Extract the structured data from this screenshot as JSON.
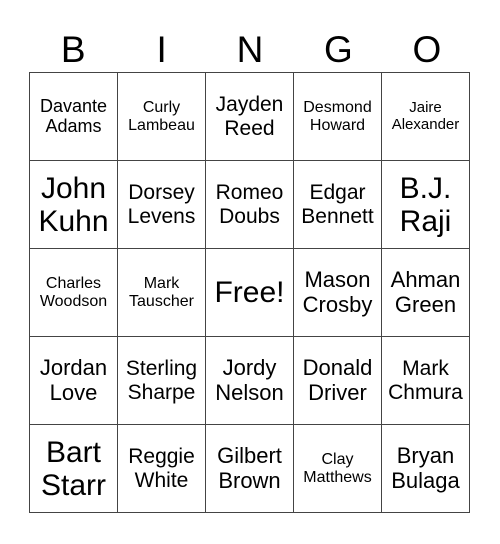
{
  "header": {
    "letters": [
      "B",
      "I",
      "N",
      "G",
      "O"
    ]
  },
  "grid": {
    "rows": [
      [
        "Davante Adams",
        "Curly Lambeau",
        "Jayden Reed",
        "Desmond Howard",
        "Jaire Alexander"
      ],
      [
        "John Kuhn",
        "Dorsey Levens",
        "Romeo Doubs",
        "Edgar Bennett",
        "B.J. Raji"
      ],
      [
        "Charles Woodson",
        "Mark Tauscher",
        "Free!",
        "Mason Crosby",
        "Ahman Green"
      ],
      [
        "Jordan Love",
        "Sterling Sharpe",
        "Jordy Nelson",
        "Donald Driver",
        "Mark Chmura"
      ],
      [
        "Bart Starr",
        "Reggie White",
        "Gilbert Brown",
        "Clay Matthews",
        "Bryan Bulaga"
      ]
    ]
  }
}
